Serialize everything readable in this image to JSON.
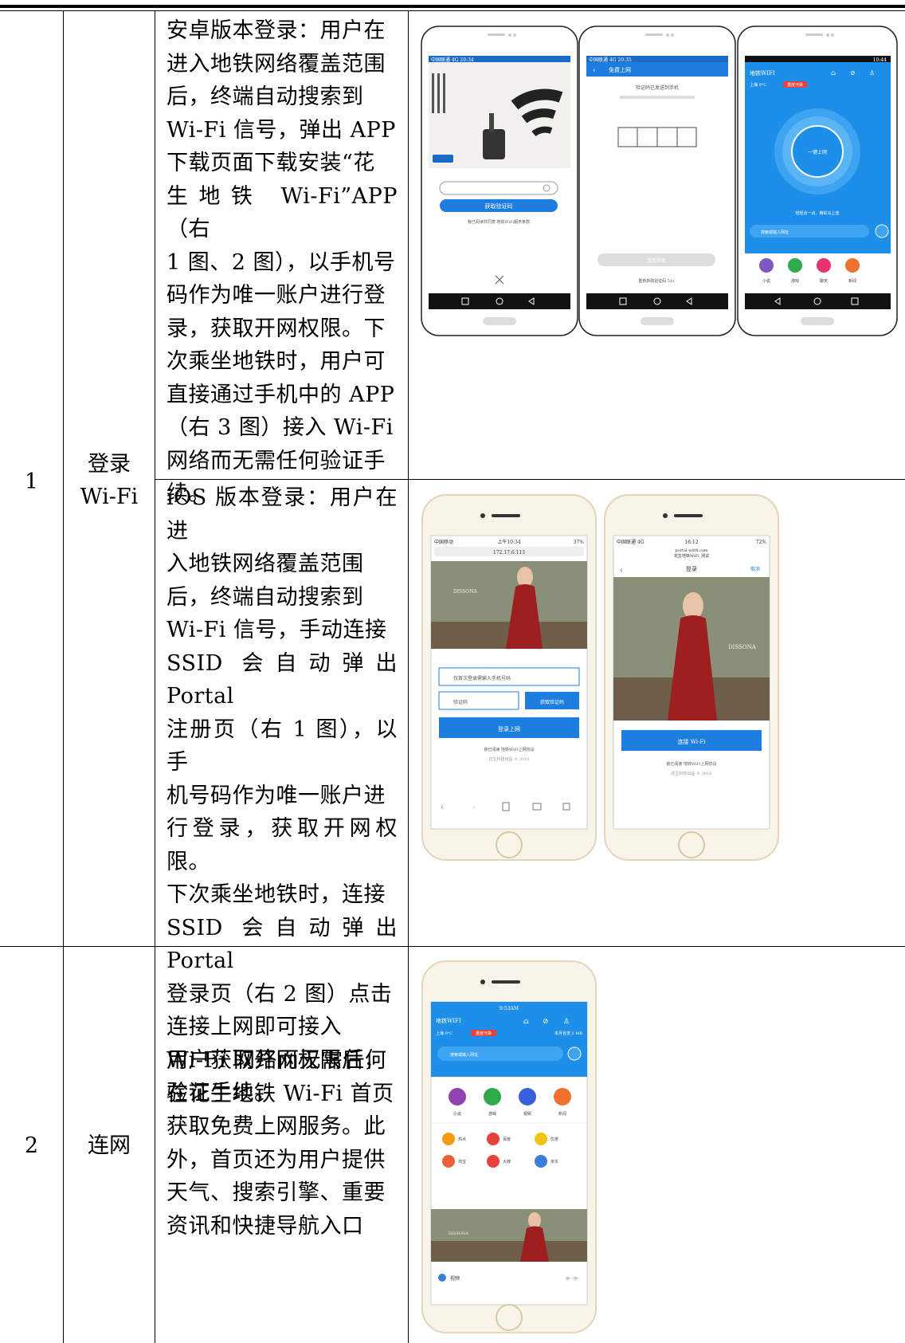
{
  "rows": [
    {
      "index": "1",
      "title_line1": "登录",
      "title_line2": "Wi-Fi"
    },
    {
      "index": "2",
      "title": "连网"
    }
  ],
  "android": {
    "lines": [
      "安卓版本登录：用户在",
      "进入地铁网络覆盖范围",
      "后，终端自动搜索到",
      "Wi-Fi 信号，弹出 APP",
      "下载页面下载安装“花",
      "生地铁 Wi-Fi”APP（右",
      "1 图、2 图），以手机号",
      "码作为唯一账户进行登",
      "录，获取开网权限。下",
      "次乘坐地铁时，用户可",
      "直接通过手机中的 APP",
      "（右 3 图）接入 Wi-Fi",
      "网络而无需任何验证手",
      "续。"
    ],
    "phone1": {
      "status": "中国联通 4G 20:34",
      "button": "获取验证码",
      "link": "我已阅读并同意 地铁WiFi服务条款",
      "icons": [
        "search-icon"
      ]
    },
    "phone2": {
      "status": "中国联通 4G 20:35",
      "header": "免费上网",
      "sent_text": "验证码已发送到手机",
      "bottom_button": "重新获取",
      "countdown": "重新获取验证码 51s"
    },
    "phone3": {
      "status": "10:44",
      "app_title": "地铁WIFI",
      "weather": "上海 9°C",
      "badge": "重度污染",
      "circle_label": "一键上网",
      "hint": "轻轻点一点，精彩马上连",
      "search": "搜索或输入网址",
      "tiles": [
        "小说",
        "游戏",
        "聊天",
        "新闻"
      ]
    }
  },
  "ios": {
    "lines": [
      "iOS 版本登录：用户在进",
      "入地铁网络覆盖范围",
      "后，终端自动搜索到",
      "Wi-Fi 信号，手动连接",
      "SSID 会自动弹出 Portal",
      "注册页（右 1 图），以手",
      "机号码作为唯一账户进",
      "行登录，获取开网权限。",
      "下次乘坐地铁时，连接",
      "SSID 会自动弹出 Portal",
      "登录页（右 2 图）点击",
      "连接上网即可接入",
      "Wi-Fi 网络而无需任何",
      "验证手续。"
    ],
    "phone1": {
      "carrier": "中国移动",
      "time": "上午10:34",
      "battery": "37%",
      "url": "172.17.6.113",
      "phone_field": "仅首次登录需输入手机号码",
      "code_field": "验证码",
      "code_button": "获取验证码",
      "login_button": "登录上网",
      "agree": "我已阅读 地铁WiFi上网协议",
      "footer": "花生科技出品 © 2016",
      "brand": "DISSONA"
    },
    "phone2": {
      "carrier": "中国联通 4G",
      "time": "18:12",
      "battery": "72%",
      "url_line1": "portal.wifi8.com",
      "url_line2": "花生地铁WiFi_测试",
      "title": "登录",
      "cancel": "取消",
      "connect_button": "连接 Wi-Fi",
      "agree": "我已阅读 地铁WiFi上网协议",
      "footer": "花生科技出品 © 2016",
      "brand": "DISSONA"
    }
  },
  "connect": {
    "lines": [
      "用户获取开网权限后，",
      "在花生地铁 Wi-Fi 首页",
      "获取免费上网服务。此",
      "外，首页还为用户提供",
      "天气、搜索引擎、重要",
      "资讯和快捷导航入口"
    ],
    "phone": {
      "time": "9:53AM",
      "app_title": "地铁WIFI",
      "weather": "上海 9°C",
      "badge": "重度污染",
      "usage": "本月省流 2 MB",
      "search": "搜索或输入网址",
      "tiles": [
        "小说",
        "游戏",
        "视频",
        "新闻"
      ],
      "links": [
        "热点",
        "百度",
        "优惠",
        "淘宝",
        "大牌",
        "京东"
      ],
      "brand": "DISSONA",
      "section": "视频",
      "refresh": "换一换"
    }
  }
}
